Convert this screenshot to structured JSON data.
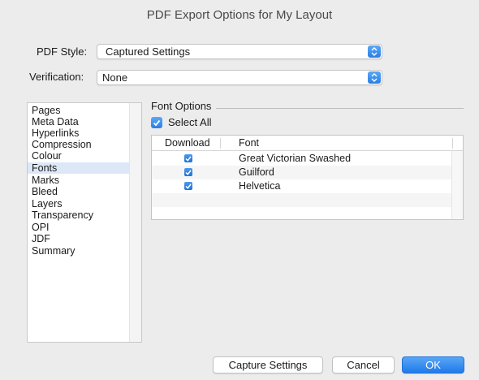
{
  "window": {
    "title": "PDF Export Options for My Layout"
  },
  "pdf_style": {
    "label": "PDF Style:",
    "value": "Captured Settings"
  },
  "verification": {
    "label": "Verification:",
    "value": "None"
  },
  "sidebar": {
    "items": [
      {
        "label": "Pages"
      },
      {
        "label": "Meta Data"
      },
      {
        "label": "Hyperlinks"
      },
      {
        "label": "Compression"
      },
      {
        "label": "Colour"
      },
      {
        "label": "Fonts",
        "selected": true
      },
      {
        "label": "Marks"
      },
      {
        "label": "Bleed"
      },
      {
        "label": "Layers"
      },
      {
        "label": "Transparency"
      },
      {
        "label": "OPI"
      },
      {
        "label": "JDF"
      },
      {
        "label": "Summary"
      }
    ]
  },
  "font_options": {
    "title": "Font Options",
    "select_all": {
      "label": "Select All",
      "checked": true
    },
    "table": {
      "headers": {
        "download": "Download",
        "font": "Font"
      },
      "rows": [
        {
          "download": true,
          "font": "Great Victorian Swashed"
        },
        {
          "download": true,
          "font": "Guilford"
        },
        {
          "download": true,
          "font": "Helvetica"
        }
      ]
    }
  },
  "buttons": {
    "capture": "Capture Settings",
    "cancel": "Cancel",
    "ok": "OK"
  },
  "colors": {
    "accent": "#2a7ee6",
    "selection": "#dce8f8",
    "background": "#ececec"
  }
}
